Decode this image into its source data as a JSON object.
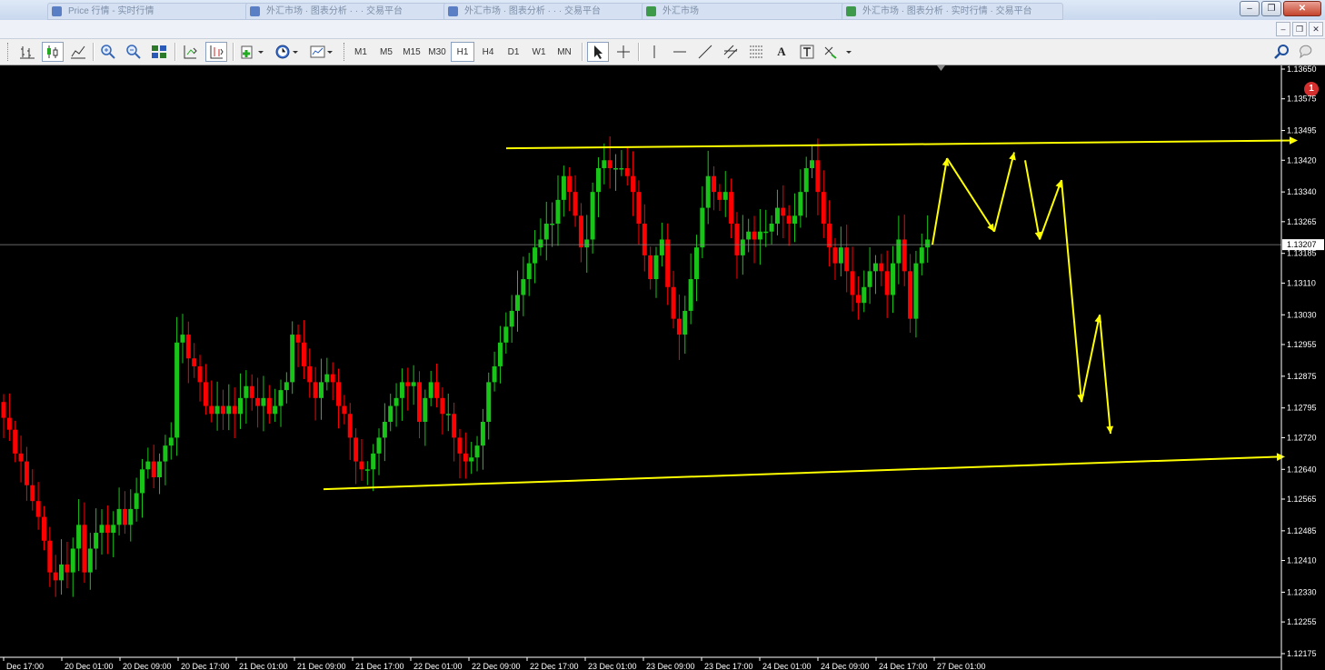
{
  "window_tabs": [
    {
      "label": "Price 行情 - 实时行情",
      "color": "#5b7fc4"
    },
    {
      "label": "外汇市场 · 图表分析 · · · 交易平台",
      "color": "#5b7fc4"
    },
    {
      "label": "外汇市场 · 图表分析 · · · 交易平台",
      "color": "#5b7fc4"
    },
    {
      "label": "外汇市场",
      "color": "#3c9a4a"
    },
    {
      "label": "外汇市场 · 图表分析 · 实时行情 · 交易平台",
      "color": "#3c9a4a"
    }
  ],
  "timeframes": [
    "M1",
    "M5",
    "M15",
    "M30",
    "H1",
    "H4",
    "D1",
    "W1",
    "MN"
  ],
  "active_timeframe": "H1",
  "notification_count": "1",
  "toolbar_text_tool": "A",
  "colors": {
    "bull": "#19c419",
    "bear": "#ff0000",
    "annotation": "#ffff00",
    "background": "#000000",
    "axis": "#ffffff"
  },
  "chart_data": {
    "type": "candlestick",
    "symbol_timeframe": "H1",
    "y_ticks": [
      "1.13650",
      "1.13575",
      "1.13495",
      "1.13420",
      "1.13340",
      "1.13265",
      "1.13185",
      "1.13110",
      "1.13030",
      "1.12955",
      "1.12875",
      "1.12795",
      "1.12720",
      "1.12640",
      "1.12565",
      "1.12485",
      "1.12410",
      "1.12330",
      "1.12255",
      "1.12175"
    ],
    "y_range": [
      1.12175,
      1.1365
    ],
    "current_price": "1.13207",
    "x_ticks": [
      "Dec 17:00",
      "20 Dec 01:00",
      "20 Dec 09:00",
      "20 Dec 17:00",
      "21 Dec 01:00",
      "21 Dec 09:00",
      "21 Dec 17:00",
      "22 Dec 01:00",
      "22 Dec 09:00",
      "22 Dec 17:00",
      "23 Dec 01:00",
      "23 Dec 09:00",
      "23 Dec 17:00",
      "24 Dec 01:00",
      "24 Dec 09:00",
      "24 Dec 17:00",
      "27 Dec 01:00"
    ],
    "close_path": [
      1.1277,
      1.1274,
      1.1268,
      1.1266,
      1.126,
      1.1256,
      1.1252,
      1.1246,
      1.1238,
      1.1236,
      1.124,
      1.1238,
      1.1244,
      1.125,
      1.1238,
      1.1244,
      1.1248,
      1.125,
      1.1248,
      1.125,
      1.1254,
      1.125,
      1.1254,
      1.1258,
      1.1264,
      1.1266,
      1.1262,
      1.1266,
      1.127,
      1.1272,
      1.1296,
      1.1298,
      1.1292,
      1.129,
      1.1286,
      1.128,
      1.1278,
      1.128,
      1.1278,
      1.128,
      1.1278,
      1.1282,
      1.1285,
      1.1282,
      1.128,
      1.1282,
      1.1278,
      1.128,
      1.1284,
      1.1286,
      1.1298,
      1.1296,
      1.129,
      1.1286,
      1.1282,
      1.1286,
      1.1288,
      1.1286,
      1.128,
      1.1278,
      1.1272,
      1.1266,
      1.1264,
      1.1264,
      1.1268,
      1.1272,
      1.1276,
      1.128,
      1.1282,
      1.1286,
      1.1285,
      1.1286,
      1.1276,
      1.1282,
      1.1286,
      1.1282,
      1.1278,
      1.1278,
      1.1272,
      1.1268,
      1.1266,
      1.1267,
      1.127,
      1.1276,
      1.1286,
      1.129,
      1.1296,
      1.13,
      1.1304,
      1.1308,
      1.1312,
      1.1316,
      1.132,
      1.1322,
      1.1326,
      1.1326,
      1.1332,
      1.1338,
      1.1334,
      1.1328,
      1.132,
      1.1322,
      1.1334,
      1.134,
      1.1342,
      1.134,
      1.134,
      1.134,
      1.1338,
      1.1334,
      1.1326,
      1.1318,
      1.1312,
      1.1318,
      1.1322,
      1.131,
      1.1302,
      1.1298,
      1.1304,
      1.1312,
      1.132,
      1.133,
      1.1338,
      1.1334,
      1.1332,
      1.1334,
      1.1326,
      1.1318,
      1.1322,
      1.1324,
      1.1322,
      1.1324,
      1.1324,
      1.1326,
      1.133,
      1.1328,
      1.1326,
      1.1328,
      1.1334,
      1.134,
      1.1342,
      1.1334,
      1.1326,
      1.132,
      1.1316,
      1.132,
      1.1314,
      1.1308,
      1.1306,
      1.131,
      1.1314,
      1.1316,
      1.1314,
      1.1308,
      1.1316,
      1.1322,
      1.1314,
      1.1302,
      1.1316,
      1.132,
      1.1322
    ],
    "annotations": {
      "resistance_line": [
        [
          0,
          1.1345
        ],
        [
          1,
          1.1347
        ]
      ],
      "support_line": [
        [
          0,
          1.1259
        ],
        [
          1,
          1.12672
        ]
      ],
      "forecast_arrows": [
        [
          1.13207,
          1.13425
        ],
        [
          1.13425,
          1.1324
        ],
        [
          1.1324,
          1.1344
        ],
        [
          1.1342,
          1.1322
        ],
        [
          1.1322,
          1.1337
        ],
        [
          1.1337,
          1.1281
        ],
        [
          1.1281,
          1.1303
        ],
        [
          1.1303,
          1.1273
        ]
      ]
    }
  }
}
